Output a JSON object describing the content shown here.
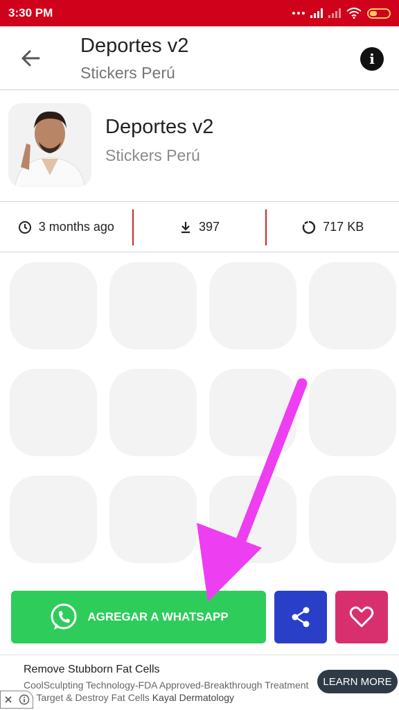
{
  "status_bar": {
    "time": "3:30 PM",
    "colors": {
      "background": "#d0021b"
    }
  },
  "toolbar": {
    "back_icon": "arrow-back-icon",
    "title": "Deportes v2",
    "subtitle": "Stickers Perú",
    "info_icon": "info-icon",
    "info_glyph": "i"
  },
  "pack": {
    "title": "Deportes v2",
    "publisher": "Stickers Perú"
  },
  "stats": {
    "updated": "3 months ago",
    "downloads": "397",
    "size": "717 KB"
  },
  "stickers": [
    {
      "name": "sticker-1"
    },
    {
      "name": "sticker-2"
    },
    {
      "name": "sticker-3"
    },
    {
      "name": "sticker-4"
    },
    {
      "name": "sticker-5"
    },
    {
      "name": "sticker-6"
    },
    {
      "name": "sticker-7"
    },
    {
      "name": "sticker-8"
    },
    {
      "name": "sticker-9"
    },
    {
      "name": "sticker-10"
    },
    {
      "name": "sticker-11"
    },
    {
      "name": "sticker-12"
    }
  ],
  "actions": {
    "add_label": "AGREGAR A WHATSAPP",
    "colors": {
      "add": "#2ecc5b",
      "share": "#2a3fc8",
      "favorite": "#d8306e"
    }
  },
  "ad": {
    "title": "Remove Stubborn Fat Cells",
    "body": "CoolSculpting Technology-FDA Approved-Breakthrough Treatment To Target & Destroy Fat Cells",
    "advertiser": "Kayal Dermatology",
    "cta": "LEARN MORE"
  }
}
